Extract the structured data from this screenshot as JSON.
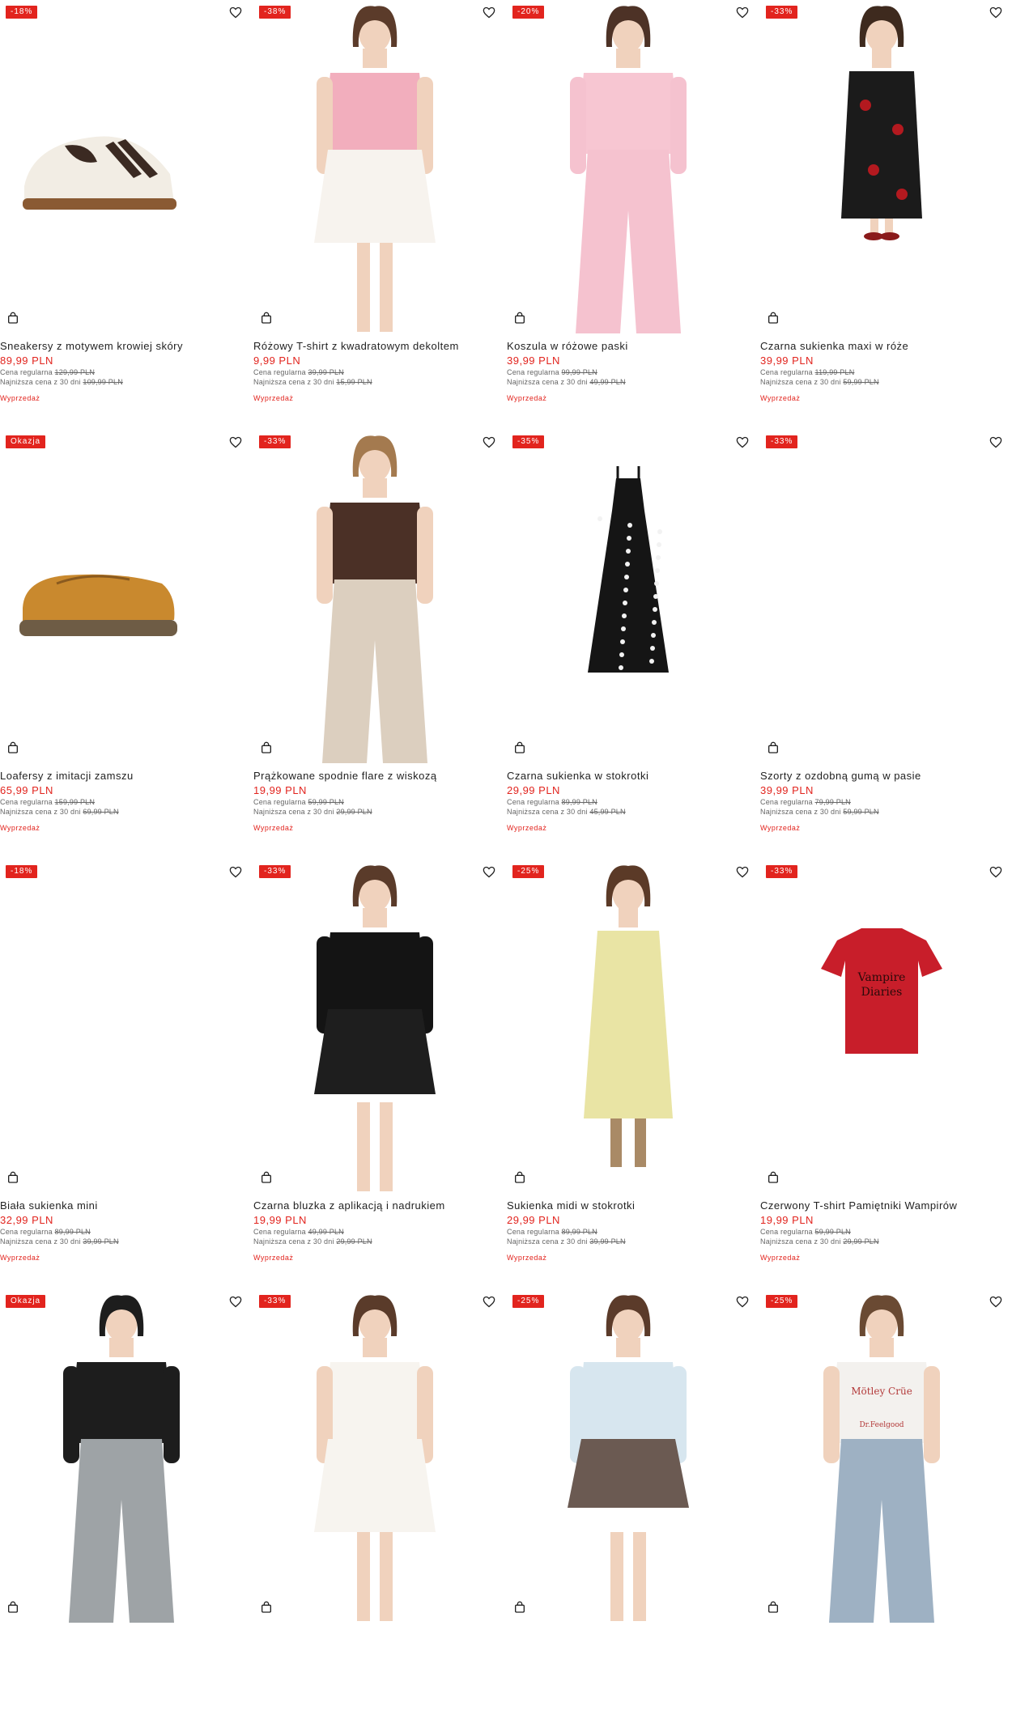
{
  "labels": {
    "regular_price_label": "Cena regularna",
    "lowest_price_label": "Najniższa cena z 30 dni"
  },
  "products": [
    {
      "badge": "-18%",
      "name": "Sneakersy z motywem krowiej skóry",
      "price": "89,99 PLN",
      "regular": "129,99 PLN",
      "lowest": "109,99 PLN",
      "sale": "Wyprzedaż",
      "image": "cow-print-sneaker"
    },
    {
      "badge": "-38%",
      "name": "Różowy T-shirt z kwadratowym dekoltem",
      "price": "9,99 PLN",
      "regular": "39,99 PLN",
      "lowest": "15,99 PLN",
      "sale": "Wyprzedaż",
      "image": "pink-tshirt-model"
    },
    {
      "badge": "-20%",
      "name": "Koszula w różowe paski",
      "price": "39,99 PLN",
      "regular": "99,99 PLN",
      "lowest": "49,99 PLN",
      "sale": "Wyprzedaż",
      "image": "pink-shirt-model"
    },
    {
      "badge": "-33%",
      "name": "Czarna sukienka maxi w róże",
      "price": "39,99 PLN",
      "regular": "119,99 PLN",
      "lowest": "59,99 PLN",
      "sale": "Wyprzedaż",
      "image": "black-rose-dress-model"
    },
    {
      "badge": "Okazja",
      "name": "Loafersy z imitacji zamszu",
      "price": "65,99 PLN",
      "regular": "159,99 PLN",
      "lowest": "69,99 PLN",
      "sale": "Wyprzedaż",
      "image": "suede-loafer"
    },
    {
      "badge": "-33%",
      "name": "Prążkowane spodnie flare z wiskozą",
      "price": "19,99 PLN",
      "regular": "59,99 PLN",
      "lowest": "29,99 PLN",
      "sale": "Wyprzedaż",
      "image": "flare-pants-model"
    },
    {
      "badge": "-35%",
      "name": "Czarna sukienka w stokrotki",
      "price": "29,99 PLN",
      "regular": "89,99 PLN",
      "lowest": "45,99 PLN",
      "sale": "Wyprzedaż",
      "image": "daisy-dress"
    },
    {
      "badge": "-33%",
      "name": "Szorty z ozdobną gumą w pasie",
      "price": "39,99 PLN",
      "regular": "79,99 PLN",
      "lowest": "59,99 PLN",
      "sale": "Wyprzedaż",
      "image": "blank"
    },
    {
      "badge": "-18%",
      "name": "Biała sukienka mini",
      "price": "32,99 PLN",
      "regular": "89,99 PLN",
      "lowest": "39,99 PLN",
      "sale": "Wyprzedaż",
      "image": "blank"
    },
    {
      "badge": "-33%",
      "name": "Czarna bluzka z aplikacją i nadrukiem",
      "price": "19,99 PLN",
      "regular": "49,99 PLN",
      "lowest": "29,99 PLN",
      "sale": "Wyprzedaż",
      "image": "black-top-model"
    },
    {
      "badge": "-25%",
      "name": "Sukienka midi w stokrotki",
      "price": "29,99 PLN",
      "regular": "89,99 PLN",
      "lowest": "39,99 PLN",
      "sale": "Wyprzedaż",
      "image": "yellow-dress-model"
    },
    {
      "badge": "-33%",
      "name": "Czerwony T-shirt Pamiętniki Wampirów",
      "price": "19,99 PLN",
      "regular": "59,99 PLN",
      "lowest": "29,99 PLN",
      "sale": "Wyprzedaż",
      "image": "red-tshirt",
      "image_text": [
        "Vampire",
        "Diaries"
      ]
    },
    {
      "badge": "Okazja",
      "name": "",
      "price": "",
      "regular": "",
      "lowest": "",
      "sale": "",
      "image": "black-zip-hoodie-model"
    },
    {
      "badge": "-33%",
      "name": "",
      "price": "",
      "regular": "",
      "lowest": "",
      "sale": "",
      "image": "white-dress-model"
    },
    {
      "badge": "-25%",
      "name": "",
      "price": "",
      "regular": "",
      "lowest": "",
      "sale": "",
      "image": "blue-sweatshirt-model"
    },
    {
      "badge": "-25%",
      "name": "",
      "price": "",
      "regular": "",
      "lowest": "",
      "sale": "",
      "image": "white-tank-model",
      "image_text": [
        "Mötley Crüe",
        "Dr.Feelgood"
      ]
    }
  ]
}
